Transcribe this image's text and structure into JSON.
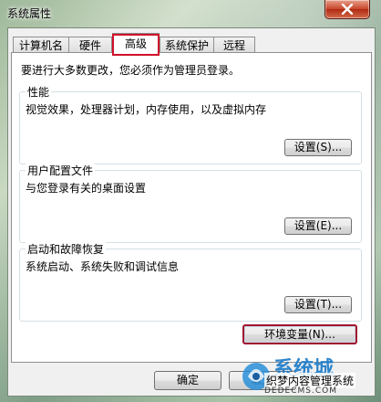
{
  "window": {
    "title": "系统属性"
  },
  "tabs": [
    {
      "label": "计算机名",
      "selected": false
    },
    {
      "label": "硬件",
      "selected": false
    },
    {
      "label": "高级",
      "selected": true
    },
    {
      "label": "系统保护",
      "selected": false
    },
    {
      "label": "远程",
      "selected": false
    }
  ],
  "notice": "要进行大多数更改，您必须作为管理员登录。",
  "groups": [
    {
      "title": "性能",
      "description": "视觉效果，处理器计划，内存使用，以及虚拟内存",
      "button": "设置(S)..."
    },
    {
      "title": "用户配置文件",
      "description": "与您登录有关的桌面设置",
      "button": "设置(E)..."
    },
    {
      "title": "启动和故障恢复",
      "description": "系统启动、系统失败和调试信息",
      "button": "设置(T)..."
    }
  ],
  "env_button": "环境变量(N)...",
  "footer": {
    "ok": "确定",
    "cancel": "取消"
  },
  "watermark": {
    "brand": "系统城",
    "line1": "织梦内容管理系统",
    "line2": "DEDECMS.COM"
  },
  "colors": {
    "highlight_red": "#d0102a",
    "close_red": "#c7452a"
  }
}
